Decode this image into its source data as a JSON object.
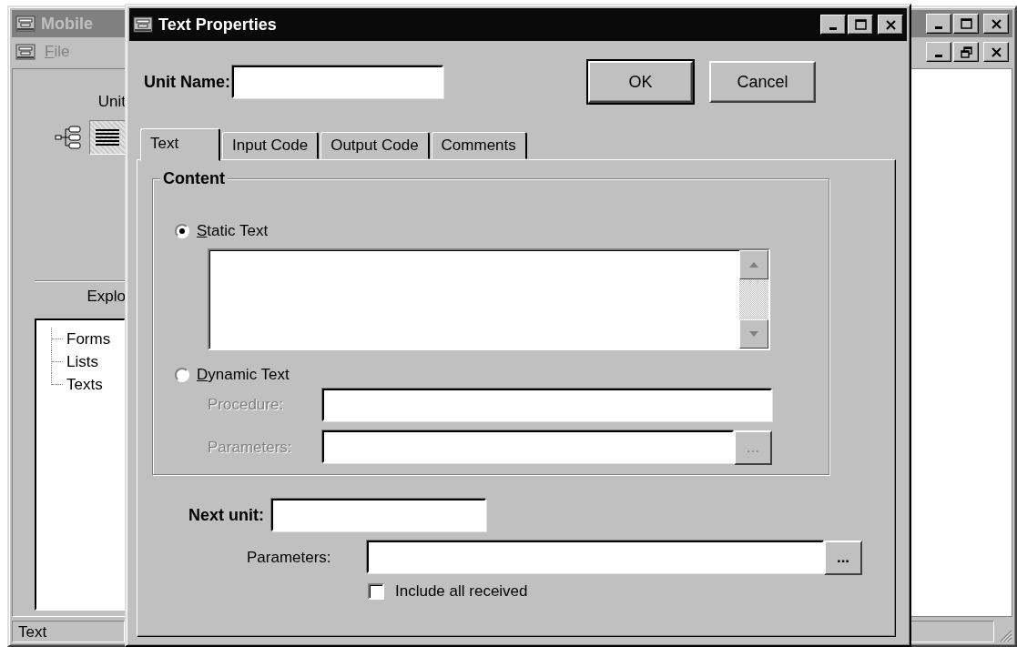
{
  "background_window": {
    "title": "Mobile",
    "active": false,
    "menu": [
      {
        "label": "File",
        "underline_first": true
      }
    ],
    "units_panel": {
      "label": "Unit",
      "view_buttons": [
        {
          "kind": "tree",
          "selected": false
        },
        {
          "kind": "list",
          "selected": true
        }
      ]
    },
    "explorer": {
      "label": "Explo",
      "tree": [
        {
          "label": "Forms"
        },
        {
          "label": "Lists"
        },
        {
          "label": "Texts"
        }
      ]
    },
    "status_bar": "Text"
  },
  "dialog": {
    "title": "Text Properties",
    "active": true,
    "unit_name": {
      "label": "Unit Name:"
    },
    "buttons": [
      {
        "label": "OK",
        "default": true
      },
      {
        "label": "Cancel",
        "default": false
      }
    ],
    "tabs": [
      {
        "label": "Text",
        "selected": true
      },
      {
        "label": "Input Code",
        "selected": false
      },
      {
        "label": "Output Code",
        "selected": false
      },
      {
        "label": "Comments",
        "selected": false
      }
    ],
    "content": {
      "title": "Content",
      "options": [
        {
          "label": "Static Text",
          "underline_first": true,
          "selected": true
        },
        {
          "label": "Dynamic Text",
          "underline_first": true,
          "selected": false
        }
      ],
      "procedure": {
        "label": "Procedure:",
        "disabled": true
      },
      "parameters": {
        "label": "Parameters:",
        "disabled": true,
        "browse": "..."
      }
    },
    "next_unit": {
      "label": "Next unit:"
    },
    "parameters": {
      "label": "Parameters:",
      "browse": "..."
    },
    "include_all_received": {
      "label": "Include all received",
      "checked": false
    }
  }
}
